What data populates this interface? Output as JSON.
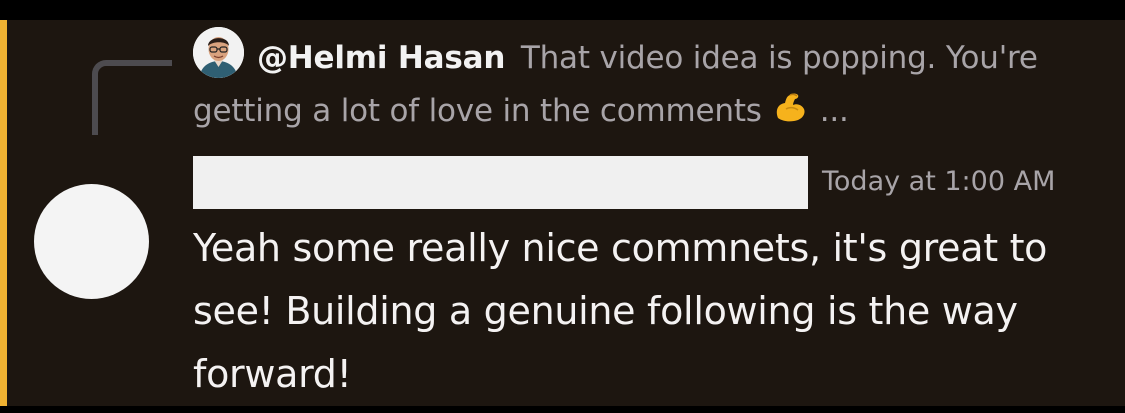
{
  "reply": {
    "author": "@Helmi Hasan",
    "text": "That video idea is popping. You're getting a lot of love in the comments",
    "emoji": "flexed-biceps",
    "ellipsis": "..."
  },
  "message": {
    "timestamp": "Today at 1:00 AM",
    "text": "Yeah some really nice commnets, it's great to see! Building a genuine following is the way forward!"
  },
  "colors": {
    "background": "#1d1610",
    "accent": "#f0b232",
    "muted_text": "#a8a4a8",
    "body_text": "#f4f2f2"
  }
}
